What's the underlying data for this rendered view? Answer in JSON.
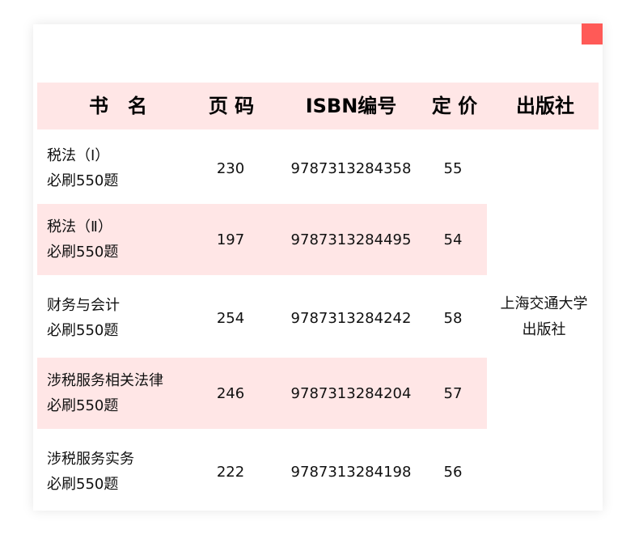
{
  "table": {
    "headers": [
      "书　名",
      "页 码",
      "ISBN编号",
      "定 价",
      "出版社"
    ],
    "rows": [
      {
        "name_line1": "税法（Ⅰ）",
        "name_line2": "必刷550题",
        "pages": "230",
        "isbn": "9787313284358",
        "price": "55"
      },
      {
        "name_line1": "税法（Ⅱ）",
        "name_line2": "必刷550题",
        "pages": "197",
        "isbn": "9787313284495",
        "price": "54"
      },
      {
        "name_line1": "财务与会计",
        "name_line2": "必刷550题",
        "pages": "254",
        "isbn": "9787313284242",
        "price": "58"
      },
      {
        "name_line1": "涉税服务相关法律",
        "name_line2": "必刷550题",
        "pages": "246",
        "isbn": "9787313284204",
        "price": "57"
      },
      {
        "name_line1": "涉税服务实务",
        "name_line2": "必刷550题",
        "pages": "222",
        "isbn": "9787313284198",
        "price": "56"
      }
    ],
    "publisher_line1": "上海交通大学",
    "publisher_line2": "出版社"
  },
  "colors": {
    "header_bg": "#ffe6e6",
    "accent": "#ff5a57"
  }
}
